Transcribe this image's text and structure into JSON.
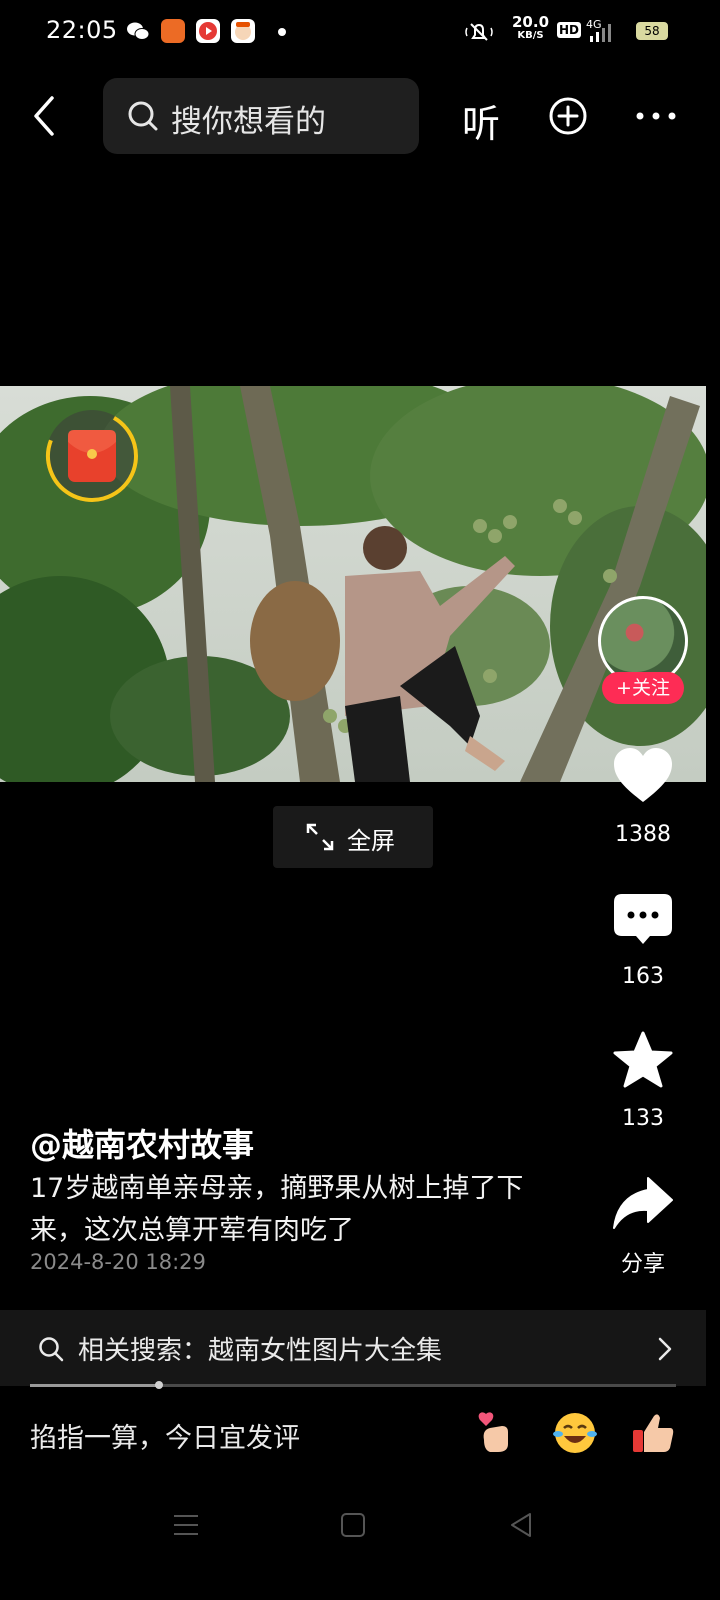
{
  "status_bar": {
    "time": "22:05",
    "network_speed_value": "20.0",
    "network_speed_unit": "KB/S",
    "hd_label": "HD",
    "network_type": "4G",
    "battery": "58"
  },
  "top_nav": {
    "search_placeholder": "搜你想看的",
    "listen_label": "听"
  },
  "video": {
    "fullscreen_label": "全屏"
  },
  "author": {
    "follow_label": "+关注",
    "name": "@越南农村故事"
  },
  "actions": {
    "likes": "1388",
    "comments": "163",
    "favorites": "133",
    "share_label": "分享"
  },
  "caption": {
    "description": "17岁越南单亲母亲，摘野果从树上掉了下来，这次总算开荤有肉吃了",
    "timestamp": "2024-8-20 18:29"
  },
  "related_search": {
    "text": "相关搜索：越南女性图片大全集",
    "playback_progress": 0.2
  },
  "comment_bar": {
    "prompt": "掐指一算，今日宜发评"
  },
  "colors": {
    "accent": "#fe2c55",
    "redpacket_ring": "#f5c518"
  }
}
